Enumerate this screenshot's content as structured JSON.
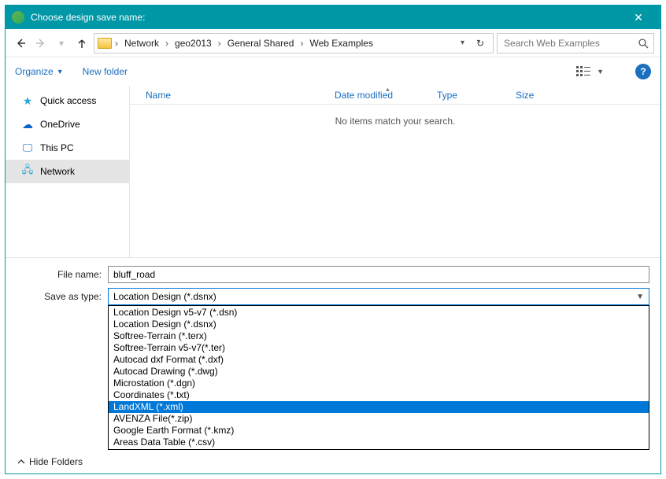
{
  "title": "Choose design save name:",
  "breadcrumbs": [
    "Network",
    "geo2013",
    "General Shared",
    "Web Examples"
  ],
  "search_placeholder": "Search Web Examples",
  "toolbar": {
    "organize": "Organize",
    "new_folder": "New folder"
  },
  "tree": {
    "quick_access": "Quick access",
    "onedrive": "OneDrive",
    "this_pc": "This PC",
    "network": "Network"
  },
  "columns": {
    "name": "Name",
    "date": "Date modified",
    "type": "Type",
    "size": "Size"
  },
  "empty_msg": "No items match your search.",
  "labels": {
    "filename": "File name:",
    "saveas": "Save as type:",
    "hide": "Hide Folders"
  },
  "filename_value": "bluff_road",
  "saveas_selected": "Location Design (*.dsnx)",
  "format_options": [
    "Location Design v5-v7 (*.dsn)",
    "Location Design (*.dsnx)",
    "Softree-Terrain (*.terx)",
    "Softree-Terrain v5-v7(*.ter)",
    "Autocad dxf Format (*.dxf)",
    "Autocad Drawing (*.dwg)",
    "Microstation (*.dgn)",
    "Coordinates (*.txt)",
    "LandXML (*.xml)",
    "AVENZA File(*.zip)",
    "Google Earth Format (*.kmz)",
    "Areas Data Table (*.csv)"
  ],
  "highlighted_option_index": 8
}
